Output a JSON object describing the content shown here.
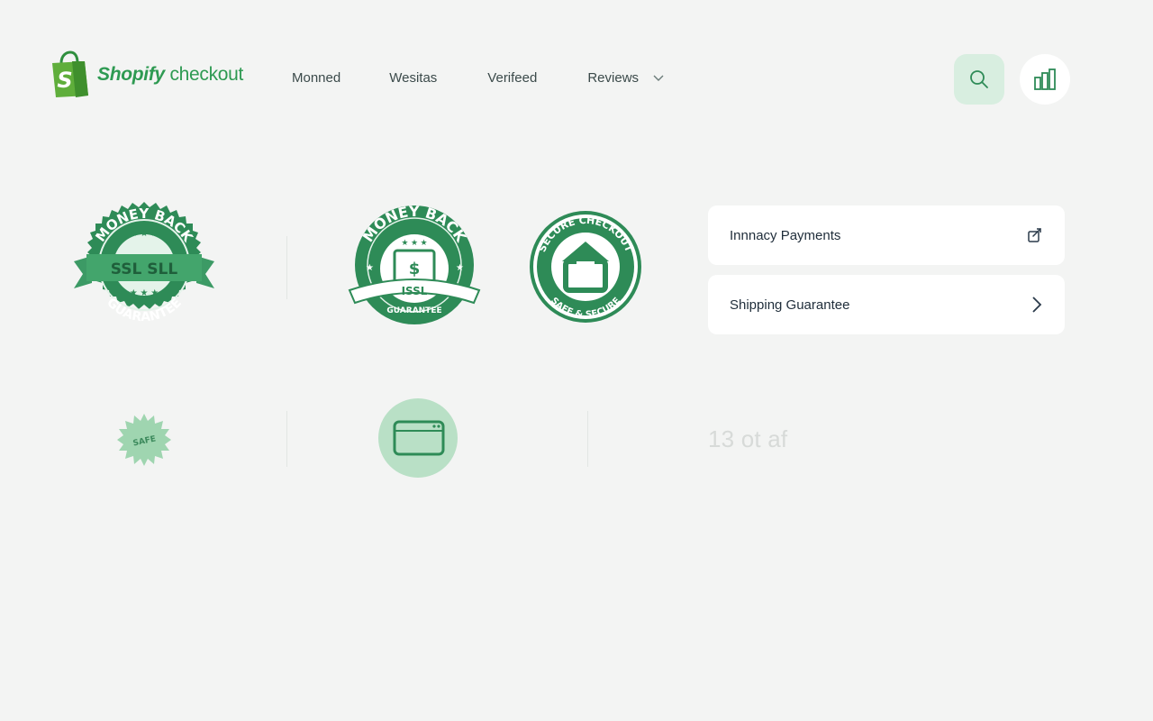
{
  "header": {
    "brand_strong": "Shopify",
    "brand_light": " checkout",
    "nav": [
      "Monned",
      "Wesitas",
      "Verifeed",
      "Reviews"
    ],
    "icons": {
      "logo": "shopping-bag-icon",
      "search": "search-icon",
      "stats": "bar-chart-icon",
      "chevron": "chevron-down-icon"
    }
  },
  "badges": {
    "badge1": {
      "top": "MONEY BACK",
      "middle": "SSL SLL",
      "bottom": "GUARANTEE"
    },
    "badge2": {
      "top": "MONEY BACK",
      "middle": "ISSL",
      "bottom": "GUARANTEE"
    },
    "badge3": {
      "top": "SECURE CHECKOUT",
      "bottom": "SAFE & SECURE"
    },
    "badge4": {
      "label": "SAFE"
    }
  },
  "cards": [
    {
      "label": "Innnacy Payments",
      "icon": "edit-box-icon"
    },
    {
      "label": "Shipping Guarantee",
      "icon": "chevron-right-icon"
    }
  ],
  "count_text": "13 ot af",
  "colors": {
    "brand_green": "#2e9a52",
    "badge_green": "#2e8b57",
    "badge_light": "#e4f3ea",
    "background": "#f3f4f3"
  }
}
